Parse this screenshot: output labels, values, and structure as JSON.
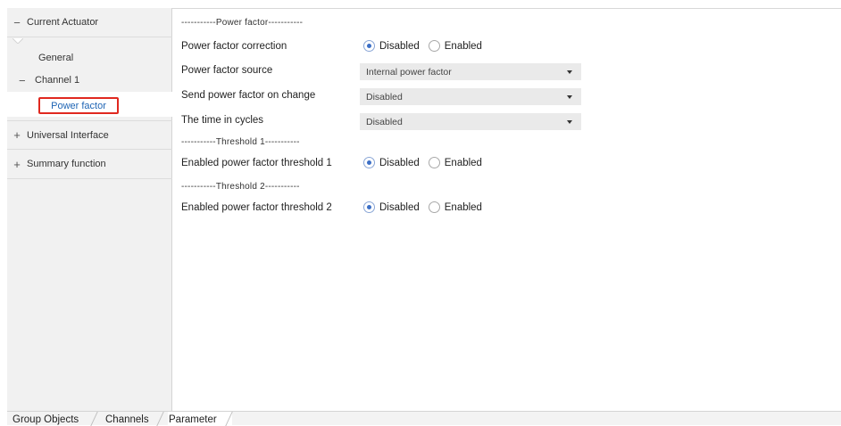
{
  "sidebar": {
    "current_actuator": {
      "sign": "−",
      "label": "Current Actuator"
    },
    "general": "General",
    "channel1": {
      "sign": "−",
      "label": "Channel 1"
    },
    "power_factor": "Power factor",
    "universal_interface": {
      "sign": "+",
      "label": "Universal Interface"
    },
    "summary_function": {
      "sign": "+",
      "label": "Summary function"
    }
  },
  "main": {
    "section_power_factor": "-----------Power factor-----------",
    "pf_correction": {
      "label": "Power factor correction",
      "opt1": "Disabled",
      "opt2": "Enabled"
    },
    "pf_source": {
      "label": "Power factor source",
      "value": "Internal power factor"
    },
    "send_on_change": {
      "label": "Send power factor on change",
      "value": "Disabled"
    },
    "time_cycles": {
      "label": "The time in cycles",
      "value": "Disabled"
    },
    "section_threshold1": "-----------Threshold 1-----------",
    "threshold1": {
      "label": "Enabled power factor threshold 1",
      "opt1": "Disabled",
      "opt2": "Enabled"
    },
    "section_threshold2": "-----------Threshold 2-----------",
    "threshold2": {
      "label": "Enabled power factor threshold 2",
      "opt1": "Disabled",
      "opt2": "Enabled"
    }
  },
  "tabs": {
    "group_objects": "Group Objects",
    "channels": "Channels",
    "parameter": "Parameter"
  }
}
